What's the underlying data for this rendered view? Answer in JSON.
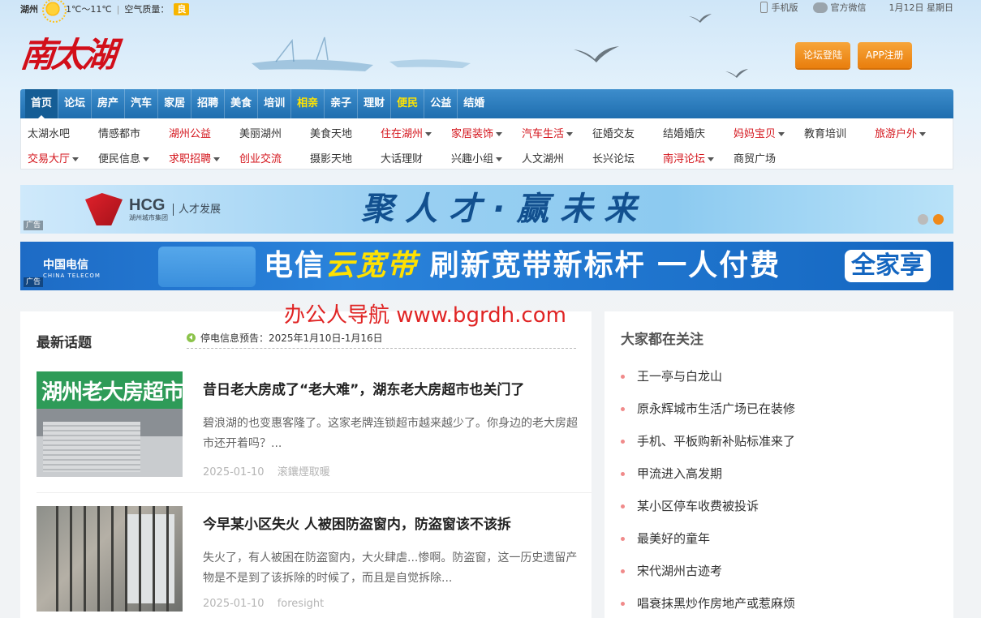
{
  "topbar": {
    "city": "湖州",
    "temperature": "1℃～11℃",
    "aqi_label": "空气质量：",
    "aqi_value": "良",
    "mobile": "手机版",
    "wechat": "官方微信",
    "date": "1月12日 星期日"
  },
  "header": {
    "logo": "南太湖",
    "login_button": "论坛登陆",
    "register_button": "APP注册"
  },
  "main_nav": [
    {
      "label": "首页"
    },
    {
      "label": "论坛"
    },
    {
      "label": "房产"
    },
    {
      "label": "汽车"
    },
    {
      "label": "家居"
    },
    {
      "label": "招聘"
    },
    {
      "label": "美食"
    },
    {
      "label": "培训"
    },
    {
      "label": "相亲"
    },
    {
      "label": "亲子"
    },
    {
      "label": "理财"
    },
    {
      "label": "便民"
    },
    {
      "label": "公益"
    },
    {
      "label": "结婚"
    }
  ],
  "sub_nav": {
    "row1": [
      {
        "label": "太湖水吧"
      },
      {
        "label": "情感都市"
      },
      {
        "label": "湖州公益"
      },
      {
        "label": "美丽湖州"
      },
      {
        "label": "美食天地"
      },
      {
        "label": "住在湖州"
      },
      {
        "label": "家居装饰"
      },
      {
        "label": "汽车生活"
      },
      {
        "label": "征婚交友"
      },
      {
        "label": "结婚婚庆"
      },
      {
        "label": "妈妈宝贝"
      },
      {
        "label": "教育培训"
      },
      {
        "label": "旅游户外"
      }
    ],
    "row2": [
      {
        "label": "交易大厅"
      },
      {
        "label": "便民信息"
      },
      {
        "label": "求职招聘"
      },
      {
        "label": "创业交流"
      },
      {
        "label": "摄影天地"
      },
      {
        "label": "大话理财"
      },
      {
        "label": "兴趣小组"
      },
      {
        "label": "人文湖州"
      },
      {
        "label": "长兴论坛"
      },
      {
        "label": "南浔论坛"
      },
      {
        "label": "商贸广场"
      }
    ]
  },
  "banners": {
    "ad_tag": "广告",
    "b1_brand": "HCG",
    "b1_brand_sub": "湖州城市集团",
    "b1_side": "人才发展",
    "b1_slogan": "聚人才·赢未来",
    "b2_brand": "中国电信",
    "b2_brand_en": "CHINA TELECOM",
    "b2_slogan_a": "电信",
    "b2_slogan_hl": "云宽带",
    "b2_slogan_b": " 刷新宽带新标杆  一人付费",
    "b2_badge": "全家享"
  },
  "latest": {
    "title": "最新话题",
    "notice": "停电信息预告：2025年1月10日-1月16日",
    "watermark": "办公人导航 www.bgrdh.com",
    "articles": [
      {
        "thumb_sign": "湖州老大房超市",
        "title": "昔日老大房成了“老大难”，湖东老大房超市也关门了",
        "summary": "碧浪湖的也变惠客隆了。这家老牌连锁超市越来越少了。你身边的老大房超市还开着吗？...",
        "date": "2025-01-10",
        "author": "滚鑲煙取暖"
      },
      {
        "title": "今早某小区失火 人被困防盗窗内，防盗窗该不该拆",
        "summary": "失火了，有人被困在防盗窗内，大火肆虐...惨啊。防盗窗，这一历史遗留产物是不是到了该拆除的时候了，而且是自觉拆除...",
        "date": "2025-01-10",
        "author": "foresight"
      }
    ]
  },
  "hot": {
    "title": "大家都在关注",
    "items": [
      {
        "label": "王一亭与白龙山"
      },
      {
        "label": "原永辉城市生活广场已在装修"
      },
      {
        "label": "手机、平板购新补贴标准来了"
      },
      {
        "label": "甲流进入高发期"
      },
      {
        "label": "某小区停车收费被投诉"
      },
      {
        "label": "最美好的童年"
      },
      {
        "label": "宋代湖州古迹考"
      },
      {
        "label": "唱衰抹黑炒作房地产或惹麻烦"
      }
    ]
  },
  "colors": {
    "nav_blue": "#1f6eaf",
    "accent_red": "#d4151c",
    "orange_button": "#e97e0d",
    "nav_highlight": "#ffe400"
  }
}
